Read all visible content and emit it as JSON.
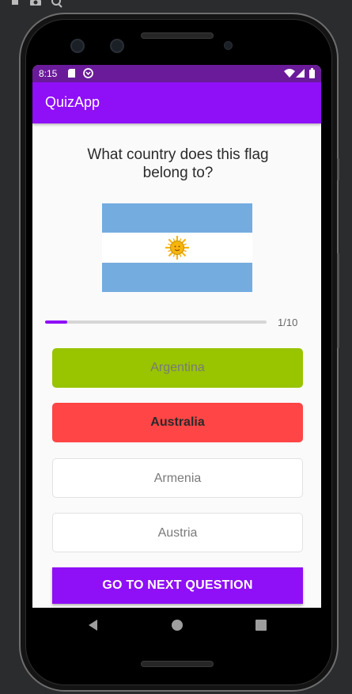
{
  "status_bar": {
    "time": "8:15",
    "icons": [
      "sd-card-icon",
      "sync-icon",
      "wifi-icon",
      "signal-icon",
      "battery-icon"
    ]
  },
  "app_bar": {
    "title": "QuizApp"
  },
  "question": {
    "text": "What country does this flag belong to?"
  },
  "flag": {
    "country_shown": "argentina-flag",
    "stripe_colors": [
      "#74acdf",
      "#ffffff",
      "#74acdf"
    ],
    "sun_color": "#f6b40e"
  },
  "progress": {
    "current": 1,
    "total": 10,
    "fraction": 0.1,
    "label": "1/10"
  },
  "options": [
    {
      "label": "Argentina",
      "state": "correct"
    },
    {
      "label": "Australia",
      "state": "wrong"
    },
    {
      "label": "Armenia",
      "state": "default"
    },
    {
      "label": "Austria",
      "state": "default"
    }
  ],
  "next_button": {
    "label": "GO TO NEXT QUESTION"
  },
  "nav": {
    "buttons": [
      "back-icon",
      "home-icon",
      "recents-icon"
    ]
  },
  "colors": {
    "primary": "#8f0ff6",
    "status_bar": "#6a1b9a",
    "correct": "#98c400",
    "wrong": "#ff4545"
  }
}
